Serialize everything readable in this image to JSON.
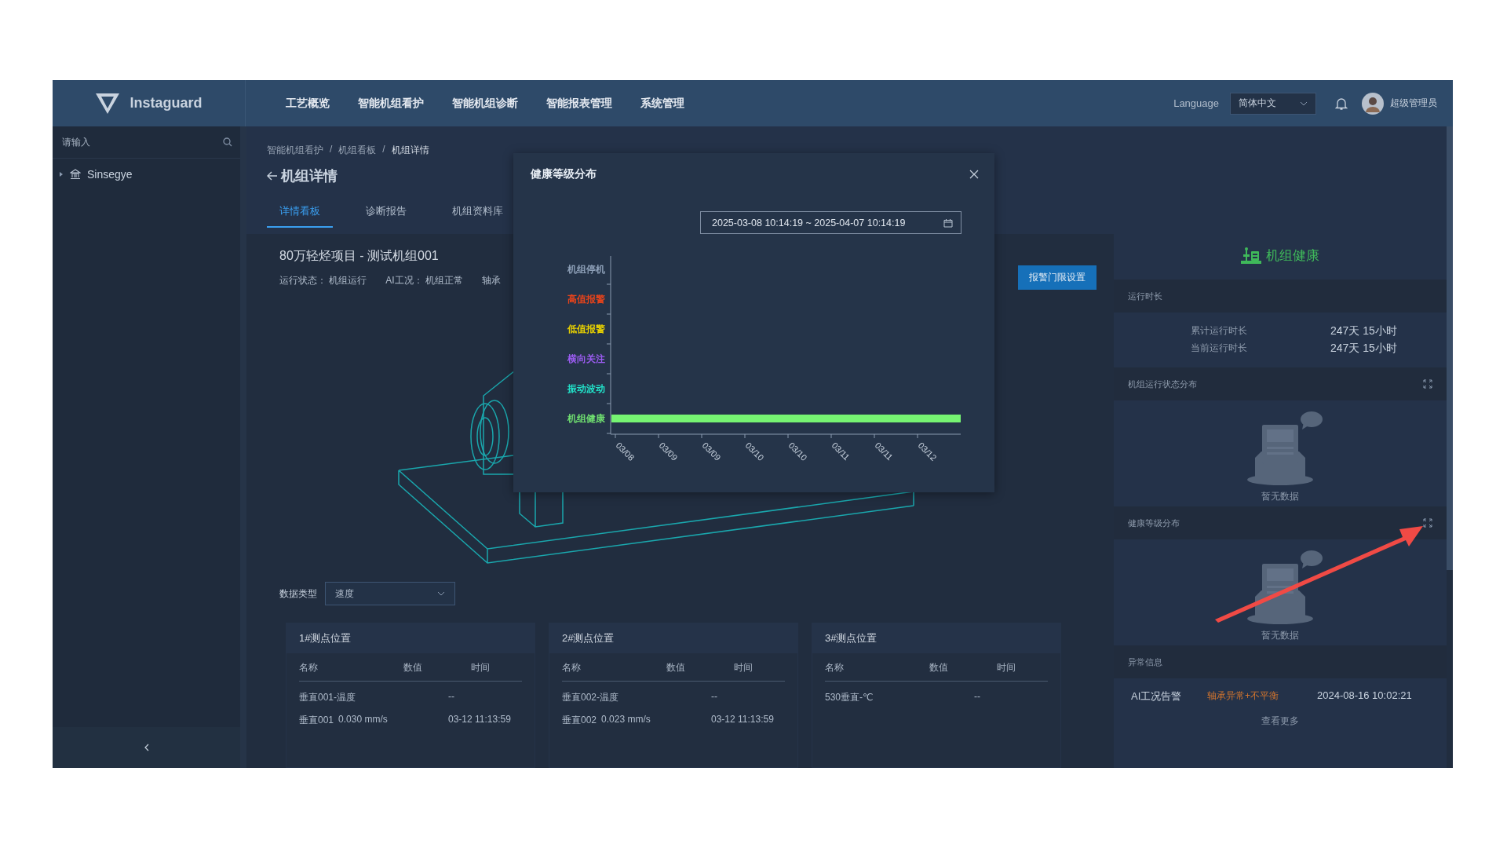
{
  "header": {
    "logo": "Instaguard",
    "nav": [
      {
        "label": "工艺概览",
        "selected": false
      },
      {
        "label": "智能机组看护",
        "selected": false
      },
      {
        "label": "智能机组诊断",
        "selected": false
      },
      {
        "label": "智能报表管理",
        "selected": false
      },
      {
        "label": "系统管理",
        "selected": false
      }
    ],
    "language_label": "Language",
    "language": "简体中文",
    "user": "超级管理员"
  },
  "sidebar": {
    "search_placeholder": "请输入",
    "tree": [
      {
        "label": "Sinsegye",
        "expanded": false
      }
    ]
  },
  "breadcrumb": [
    {
      "kind": "link",
      "text": "智能机组看护"
    },
    {
      "kind": "separator",
      "text": "/"
    },
    {
      "kind": "link",
      "text": "机组看板"
    },
    {
      "kind": "separator",
      "text": "/"
    },
    {
      "kind": "current",
      "text": "机组详情"
    }
  ],
  "page_title": "机组详情",
  "tabs": [
    {
      "label": "详情看板",
      "selected": true
    },
    {
      "label": "诊断报告",
      "selected": false
    },
    {
      "label": "机组资料库",
      "selected": false
    }
  ],
  "unit": {
    "title": "80万轻烃项目 - 测试机组001",
    "status": [
      {
        "label": "运行状态：",
        "value": "机组运行"
      },
      {
        "label": "AI工况：",
        "value": "机组正常"
      },
      {
        "label": "轴承"
      }
    ]
  },
  "alarm_button": "报警门限设置",
  "data_type": {
    "label": "数据类型",
    "value": "速度"
  },
  "points": [
    {
      "title": "1#测点位置",
      "columns": [
        "名称",
        "数值",
        "时间"
      ],
      "rows": [
        {
          "name": "垂直001-温度",
          "time": "--"
        },
        {
          "name": "垂直001",
          "value": "0.030 mm/s",
          "time": "03-12 11:13:59"
        }
      ]
    },
    {
      "title": "2#测点位置",
      "columns": [
        "名称",
        "数值",
        "时间"
      ],
      "rows": [
        {
          "name": "垂直002-温度",
          "time": "--"
        },
        {
          "name": "垂直002",
          "value": "0.023 mm/s",
          "time": "03-12 11:13:59"
        }
      ]
    },
    {
      "title": "3#测点位置",
      "columns": [
        "名称",
        "数值",
        "时间"
      ],
      "rows": [
        {
          "name": "530垂直-℃",
          "time": "--"
        }
      ]
    }
  ],
  "right_panel": {
    "title": "机组健康",
    "runtime": {
      "title": "运行时长",
      "rows": [
        {
          "label": "累计运行时长",
          "value": "247天 15小时"
        },
        {
          "label": "当前运行时长",
          "value": "247天 15小时"
        }
      ]
    },
    "charts": [
      {
        "title": "机组运行状态分布",
        "empty_text": "暂无数据"
      },
      {
        "title": "健康等级分布",
        "empty_text": "暂无数据"
      }
    ],
    "alerts": {
      "title": "异常信息",
      "rows": [
        {
          "type": "AI工况告警",
          "detail": "轴承异常+不平衡",
          "time": "2024-08-16 10:02:21"
        }
      ],
      "more": "查看更多"
    }
  },
  "modal": {
    "title": "健康等级分布",
    "date_range": "2025-03-08 10:14:19 ~ 2025-04-07 10:14:19",
    "chart": {
      "levels": [
        {
          "label": "机组停机",
          "color": "#8ea0b8",
          "has_bar": false
        },
        {
          "label": "高值报警",
          "color": "#e5431b",
          "has_bar": false
        },
        {
          "label": "低值报警",
          "color": "#e7d000",
          "has_bar": false
        },
        {
          "label": "横向关注",
          "color": "#9b5cf0",
          "has_bar": false
        },
        {
          "label": "振动波动",
          "color": "#22e0c8",
          "has_bar": false
        },
        {
          "label": "机组健康",
          "color": "#70e070",
          "has_bar": true
        }
      ],
      "dates": [
        "03/08",
        "03/09",
        "03/09",
        "03/10",
        "03/10",
        "03/11",
        "03/11",
        "03/12"
      ]
    }
  }
}
